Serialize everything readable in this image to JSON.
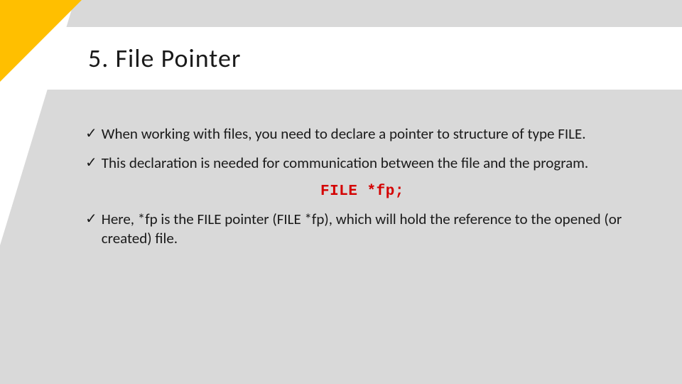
{
  "icons": {
    "check": "✓"
  },
  "slide": {
    "title": "5. File Pointer",
    "bullets": [
      "When working with files, you need to declare a pointer to structure of type FILE.",
      "This declaration is needed for communication between the file and the program."
    ],
    "code": "FILE *fp;",
    "bullets2": [
      "Here, *fp is the FILE pointer (FILE *fp), which will hold the reference to the opened (or created) file."
    ]
  }
}
